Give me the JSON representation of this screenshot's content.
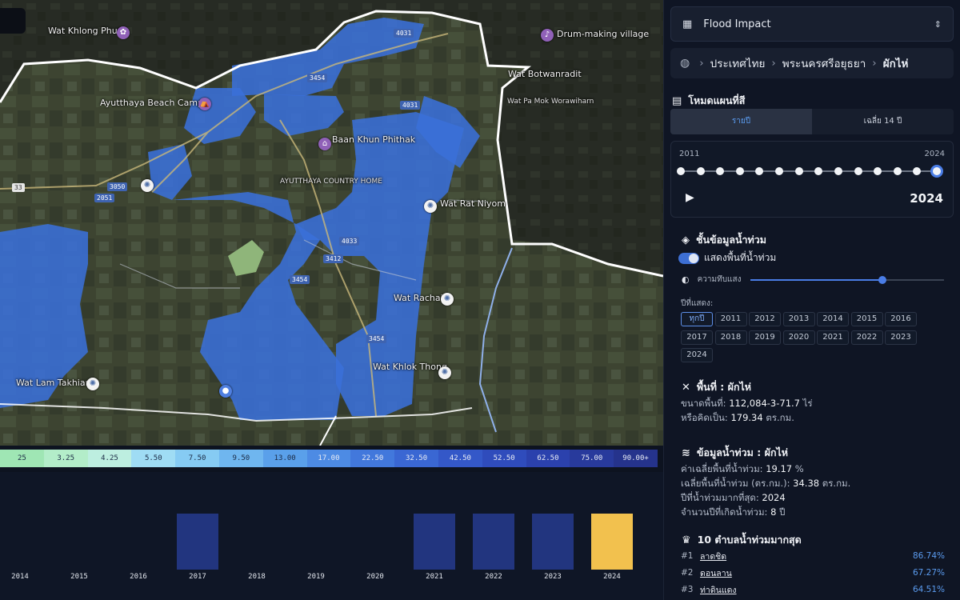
{
  "dropdown": {
    "label": "Flood Impact",
    "icon": "building-icon"
  },
  "breadcrumb": {
    "items": [
      "ประเทศไทย",
      "พระนครศรีอยุธยา",
      "ผักไห่"
    ]
  },
  "map_mode": {
    "title": "โหมดแผนที่สี",
    "tabs": [
      {
        "label": "รายปี",
        "active": true
      },
      {
        "label": "เฉลี่ย 14 ปี",
        "active": false
      }
    ]
  },
  "timeline": {
    "start": "2011",
    "end": "2024",
    "current": "2024",
    "years": [
      "2011",
      "2012",
      "2013",
      "2014",
      "2015",
      "2016",
      "2017",
      "2018",
      "2019",
      "2020",
      "2021",
      "2022",
      "2023",
      "2024"
    ]
  },
  "flood_layer": {
    "title": "ชั้นข้อมูลน้ำท่วม",
    "toggle_label": "แสดงพื้นที่น้ำท่วม",
    "toggle_on": true,
    "opacity_label": "ความทึบแสง",
    "opacity_value": 0.68,
    "years_label": "ปีที่แสดง:",
    "year_chips": [
      "ทุกปี",
      "2011",
      "2012",
      "2013",
      "2014",
      "2015",
      "2016",
      "2017",
      "2018",
      "2019",
      "2020",
      "2021",
      "2022",
      "2023",
      "2024"
    ],
    "selected_chip": "ทุกปี"
  },
  "area": {
    "title": "พื้นที่ : ผักไห่",
    "size_label": "ขนาดพื้นที่:",
    "size_value": "112,084-3-71.7",
    "size_unit": "ไร่",
    "or_label": "หรือคิดเป็น:",
    "or_value": "179.34",
    "or_unit": "ตร.กม."
  },
  "flood_info": {
    "title": "ข้อมูลน้ำท่วม : ผักไห่",
    "avg_pct_label": "ค่าเฉลี่ยพื้นที่น้ำท่วม:",
    "avg_pct_value": "19.17",
    "avg_pct_unit": "%",
    "avg_area_label": "เฉลี่ยพื้นที่น้ำท่วม (ตร.กม.):",
    "avg_area_value": "34.38",
    "avg_area_unit": "ตร.กม.",
    "max_year_label": "ปีที่น้ำท่วมมากที่สุด:",
    "max_year_value": "2024",
    "count_label": "จำนวนปีที่เกิดน้ำท่วม:",
    "count_value": "8",
    "count_unit": "ปี"
  },
  "top10": {
    "title": "10 ตำบลน้ำท่วมมากสุด",
    "rows": [
      {
        "rank": "#1",
        "name": "ลาดชิด",
        "pct": "86.74%"
      },
      {
        "rank": "#2",
        "name": "ดอนลาน",
        "pct": "67.27%"
      },
      {
        "rank": "#3",
        "name": "ท่าดินแดง",
        "pct": "64.51%"
      }
    ]
  },
  "legend": {
    "values": [
      "25",
      "3.25",
      "4.25",
      "5.50",
      "7.50",
      "9.50",
      "13.00",
      "17.00",
      "22.50",
      "32.50",
      "42.50",
      "52.50",
      "62.50",
      "75.00",
      "90.00+"
    ],
    "colors": [
      "#9fe6b4",
      "#b3edc9",
      "#bdeee0",
      "#9fdcf4",
      "#86cbf3",
      "#6fb6ef",
      "#5aa0ea",
      "#4d8be4",
      "#4278dc",
      "#3a67d3",
      "#3458c8",
      "#2f4cbc",
      "#2b41ad",
      "#283a9c",
      "#25338c"
    ]
  },
  "chart_data": {
    "type": "bar",
    "categories": [
      "2014",
      "2015",
      "2016",
      "2017",
      "2018",
      "2019",
      "2020",
      "2021",
      "2022",
      "2023",
      "2024"
    ],
    "values": [
      0,
      0,
      0,
      1,
      0,
      0,
      0,
      1,
      1,
      1,
      1
    ],
    "highlight": "2024",
    "colors": {
      "bar": "#22357f",
      "highlight": "#f2c14e"
    }
  },
  "map": {
    "labels": [
      {
        "text": "Ayutthaya Beach Camp",
        "cls": ""
      },
      {
        "text": "Wat Khlong Phum",
        "cls": ""
      },
      {
        "text": "Baan Khun Phithak",
        "cls": ""
      },
      {
        "text": "AYUTTHAYA COUNTRY HOME",
        "cls": "small"
      },
      {
        "text": "Wat Rat Niyom",
        "cls": ""
      },
      {
        "text": "Wat Rachai",
        "cls": ""
      },
      {
        "text": "Wat Khlok Thong",
        "cls": ""
      },
      {
        "text": "Wat Lam Takhian",
        "cls": ""
      },
      {
        "text": "Wat Botwanradit",
        "cls": ""
      },
      {
        "text": "Wat Pa Mok Worawiharn",
        "cls": "small"
      },
      {
        "text": "Drum-making village",
        "cls": ""
      }
    ],
    "shields": [
      "33",
      "3050",
      "2051",
      "3454",
      "3412",
      "4031",
      "3454",
      "4033",
      "3454",
      "4031"
    ]
  }
}
